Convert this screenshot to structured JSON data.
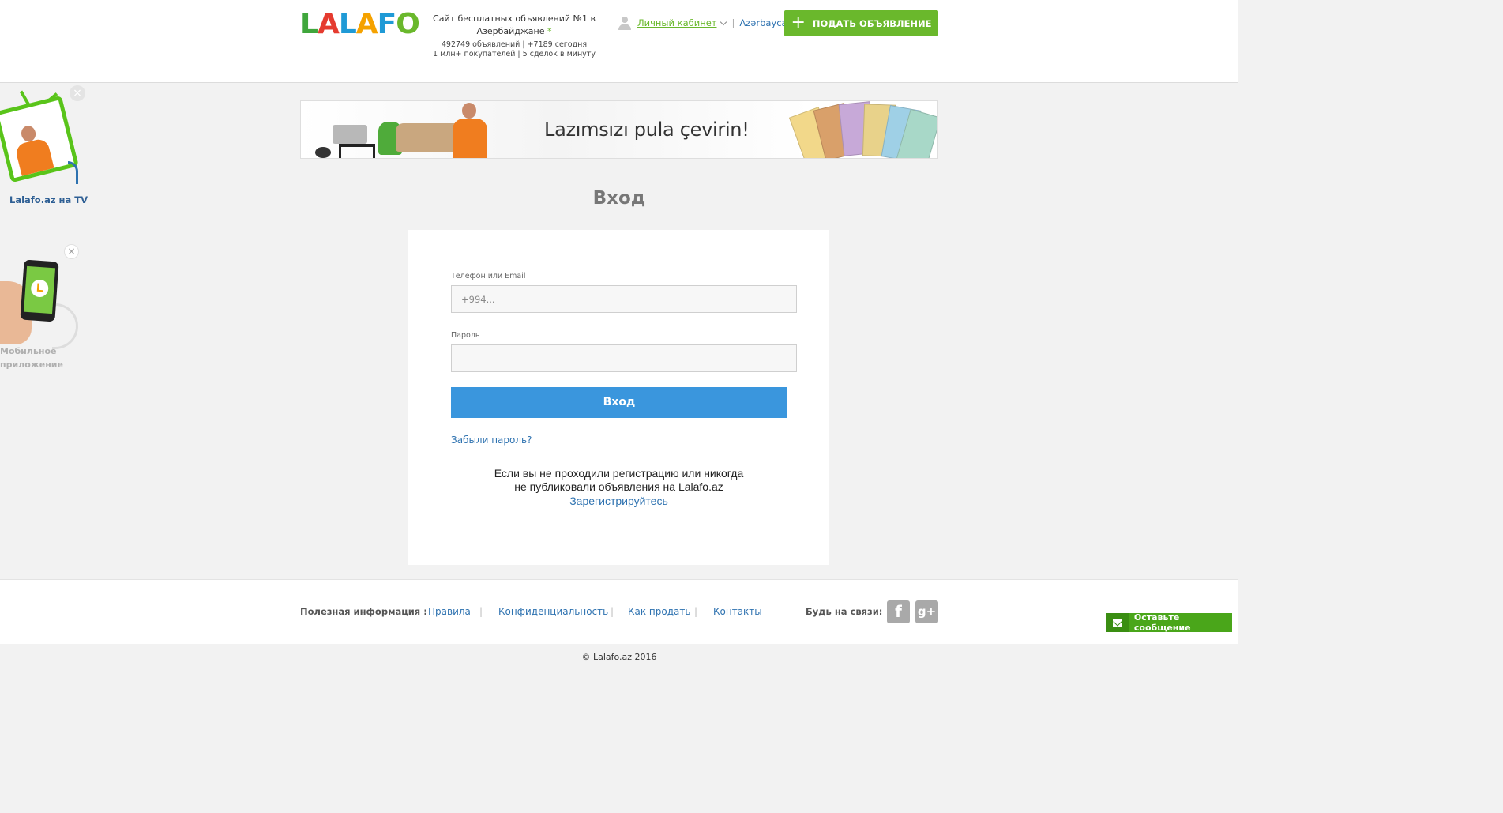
{
  "header": {
    "logo_letters": [
      {
        "char": "L",
        "color": "#3fa63c"
      },
      {
        "char": "A",
        "color": "#e53b2f"
      },
      {
        "char": "L",
        "color": "#1f9ad6"
      },
      {
        "char": "A",
        "color": "#f5a200"
      },
      {
        "char": "F",
        "color": "#1f9ad6"
      },
      {
        "char": "O",
        "color": "#6ab82c"
      }
    ],
    "tagline_line1": "Сайт бесплатных объявлений №1 в",
    "tagline_line2": "Азербайджане",
    "tagline_star": "*",
    "stats_line1": "492749 объявлений | +7189 сегодня",
    "stats_line2": "1 млн+ покупателей | 5 сделок в минуту",
    "cabinet_label": "Личный кабинет",
    "separator": "|",
    "language_label": "Azərbaycan",
    "post_ad_icon": "+",
    "post_ad_label": "ПОДАТЬ ОБЪЯВЛЕНИЕ"
  },
  "promos": {
    "tv_label": "Lalafo.az на TV",
    "tv_close": "×",
    "app_label_line1": "Мобильное",
    "app_label_line2": "приложение",
    "app_close": "×",
    "app_logo_letter": "L"
  },
  "banner": {
    "text": "Lazımsızı pula çevirin!"
  },
  "login": {
    "title": "Вход",
    "phone_label": "Телефон или Email",
    "phone_placeholder": "+994...",
    "password_label": "Пароль",
    "password_value": "",
    "submit_label": "Вход",
    "forgot_label": "Забыли пароль?",
    "register_text_line1": "Если вы не проходили регистрацию или никогда",
    "register_text_line2": "не публиковали объявления на Lalafo.az",
    "register_link": "Зарегистрируйтесь"
  },
  "footer": {
    "info_label": "Полезная информация :",
    "links": [
      "Правила",
      "Конфиденциальность",
      "Как продать",
      "Контакты"
    ],
    "separator": "|",
    "stay_connected": "Будь на связи:",
    "facebook_glyph": "f",
    "google_glyph": "g+",
    "copyright": "© Lalafo.az 2016"
  },
  "chat": {
    "label": "Оставьте сообщение"
  },
  "colors": {
    "brand_green": "#6ab82c",
    "link_blue": "#2e72b0",
    "button_blue": "#3a96dd"
  }
}
